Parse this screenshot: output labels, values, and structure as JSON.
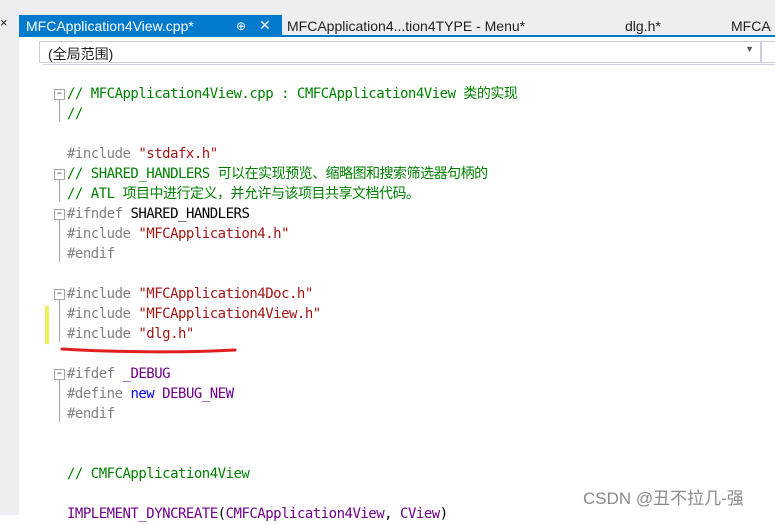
{
  "tabs": [
    {
      "label": "MFCApplication4View.cpp*",
      "active": true
    },
    {
      "label": "MFCApplication4...tion4TYPE - Menu*",
      "active": false
    },
    {
      "label": "dlg.h*",
      "active": false
    },
    {
      "label": "MFCA",
      "active": false
    }
  ],
  "left_close_glyph": "×",
  "pin_icon_glyph": "⊕",
  "close_icon_glyph": "✕",
  "navbar": {
    "scope": "(全局范围)",
    "dropdown_glyph": "▼"
  },
  "code_lines": [
    [
      {
        "t": "// MFCApplication4View.cpp : CMFCApplication4View 类的实现",
        "c": "comment"
      }
    ],
    [
      {
        "t": "//",
        "c": "comment"
      }
    ],
    [],
    [
      {
        "t": "#include ",
        "c": "pre"
      },
      {
        "t": "\"stdafx.h\"",
        "c": "str"
      }
    ],
    [
      {
        "t": "// SHARED_HANDLERS 可以在实现预览、缩略图和搜索筛选器句柄的",
        "c": "comment"
      }
    ],
    [
      {
        "t": "// ATL 项目中进行定义，并允许与该项目共享文档代码。",
        "c": "comment"
      }
    ],
    [
      {
        "t": "#ifndef ",
        "c": "pre"
      },
      {
        "t": "SHARED_HANDLERS",
        "c": "plain"
      }
    ],
    [
      {
        "t": "#include ",
        "c": "pre"
      },
      {
        "t": "\"MFCApplication4.h\"",
        "c": "str"
      }
    ],
    [
      {
        "t": "#endif",
        "c": "pre"
      }
    ],
    [],
    [
      {
        "t": "#include ",
        "c": "pre"
      },
      {
        "t": "\"MFCApplication4Doc.h\"",
        "c": "str"
      }
    ],
    [
      {
        "t": "#include ",
        "c": "pre"
      },
      {
        "t": "\"MFCApplication4View.h\"",
        "c": "str"
      }
    ],
    [
      {
        "t": "#include ",
        "c": "pre"
      },
      {
        "t": "\"dlg.h\"",
        "c": "str"
      }
    ],
    [],
    [
      {
        "t": "#ifdef ",
        "c": "pre"
      },
      {
        "t": "_DEBUG",
        "c": "macro"
      }
    ],
    [
      {
        "t": "#define ",
        "c": "pre"
      },
      {
        "t": "new ",
        "c": "kw"
      },
      {
        "t": "DEBUG_NEW",
        "c": "macro"
      }
    ],
    [
      {
        "t": "#endif",
        "c": "pre"
      }
    ],
    [],
    [],
    [
      {
        "t": "// CMFCApplication4View",
        "c": "comment"
      }
    ],
    [],
    [
      {
        "t": "IMPLEMENT_DYNCREATE",
        "c": "macro"
      },
      {
        "t": "(",
        "c": "plain"
      },
      {
        "t": "CMFCApplication4View",
        "c": "macro"
      },
      {
        "t": ", ",
        "c": "plain"
      },
      {
        "t": "CView",
        "c": "macro"
      },
      {
        "t": ")",
        "c": "plain"
      }
    ]
  ],
  "colors": {
    "comment": "#008000",
    "preprocessor": "#808080",
    "string": "#a31515",
    "macro": "#6f008a",
    "keyword": "#0000ff",
    "accent": "#007acc",
    "annotation": "#e02020",
    "change_marker": "#efef60"
  },
  "watermark": "CSDN @丑不拉几-强"
}
